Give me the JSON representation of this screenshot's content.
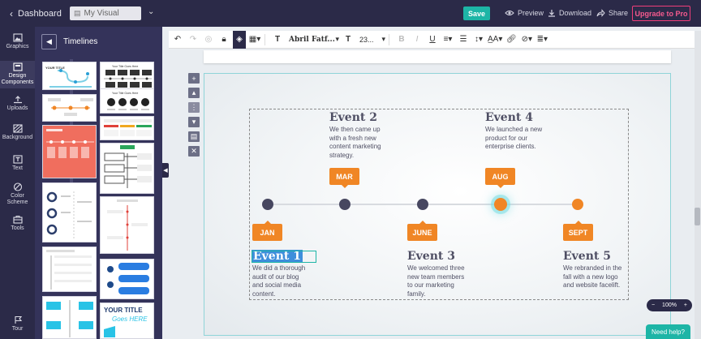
{
  "topbar": {
    "back_label": "Dashboard",
    "doc_name": "My Visual",
    "save_label": "Save",
    "preview_label": "Preview",
    "download_label": "Download",
    "share_label": "Share",
    "upgrade_label": "Upgrade to Pro"
  },
  "rail": {
    "items": [
      {
        "label": "Graphics",
        "icon": "graphics-icon"
      },
      {
        "label": "Design Components",
        "icon": "components-icon"
      },
      {
        "label": "Uploads",
        "icon": "upload-icon"
      },
      {
        "label": "Background",
        "icon": "background-icon"
      },
      {
        "label": "Text",
        "icon": "text-icon"
      },
      {
        "label": "Color Scheme",
        "icon": "palette-icon"
      },
      {
        "label": "Tools",
        "icon": "tools-icon"
      },
      {
        "label": "Tour",
        "icon": "tour-icon"
      }
    ]
  },
  "panel": {
    "title": "Timelines",
    "thumb_your_title": "YOUR TITLE",
    "thumb_goes_here": "Goes HERE",
    "thumb_title_small": "Your Title Goes Here"
  },
  "toolbar": {
    "font": "Abril Fatf...",
    "size": "23..."
  },
  "canvas": {
    "events": [
      {
        "title": "Event 1",
        "month": "JAN",
        "desc": [
          "We did a thorough",
          "audit of our blog",
          "and social media",
          "content."
        ]
      },
      {
        "title": "Event 2",
        "month": "MAR",
        "desc": [
          "We then came up",
          "with a fresh new",
          "content marketing",
          "strategy."
        ]
      },
      {
        "title": "Event 3",
        "month": "JUNE",
        "desc": [
          "We welcomed three",
          "new team members",
          "to our marketing",
          "family."
        ]
      },
      {
        "title": "Event 4",
        "month": "AUG",
        "desc": [
          "We launched a new",
          "product for our",
          "enterprise clients."
        ]
      },
      {
        "title": "Event 5",
        "month": "SEPT",
        "desc": [
          "We rebranded in the",
          "fall with a new logo",
          "and website facelift."
        ]
      }
    ]
  },
  "zoom": {
    "value": "100%",
    "minus": "−",
    "plus": "+"
  },
  "help_label": "Need help?",
  "colors": {
    "accent": "#1db5a6",
    "orange": "#f08625",
    "navy": "#2b2a48",
    "upgrade": "#f03e7a"
  }
}
